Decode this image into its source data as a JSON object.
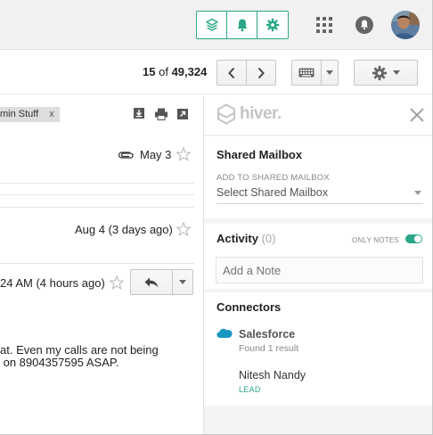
{
  "header": {
    "hiver_buttons": [
      {
        "icon": "layers-icon"
      },
      {
        "icon": "bell-icon"
      },
      {
        "icon": "gear-icon"
      }
    ],
    "apps_icon": "grid-icon",
    "notifications_icon": "bell-icon",
    "avatar": "user-avatar"
  },
  "toolbar": {
    "pager_current": "15",
    "pager_of": "of",
    "pager_total": "49,324"
  },
  "mail": {
    "label_text": "min Stuff",
    "label_close": "x",
    "messages": [
      {
        "date": "May 3"
      },
      {
        "date": "Aug 4 (3 days ago)"
      },
      {
        "date": "24 AM (4 hours ago)"
      }
    ],
    "body_line1": "at. Even my calls are not being",
    "body_line2": " on 8904357595 ASAP."
  },
  "hiver": {
    "logo_text": "hiver.",
    "shared_mailbox": {
      "title": "Shared Mailbox",
      "field_label": "ADD TO SHARED MAILBOX",
      "field_value": "Select Shared Mailbox"
    },
    "activity": {
      "title": "Activity",
      "count": "(0)",
      "toggle_label": "ONLY NOTES",
      "toggle_on": true,
      "note_placeholder": "Add a Note"
    },
    "connectors": {
      "title": "Connectors",
      "name": "Salesforce",
      "found": "Found 1 result",
      "contact_name": "Nitesh Nandy",
      "contact_tag": "LEAD"
    }
  },
  "colors": {
    "accent": "#2aa788",
    "salesforce": "#1798c1"
  }
}
